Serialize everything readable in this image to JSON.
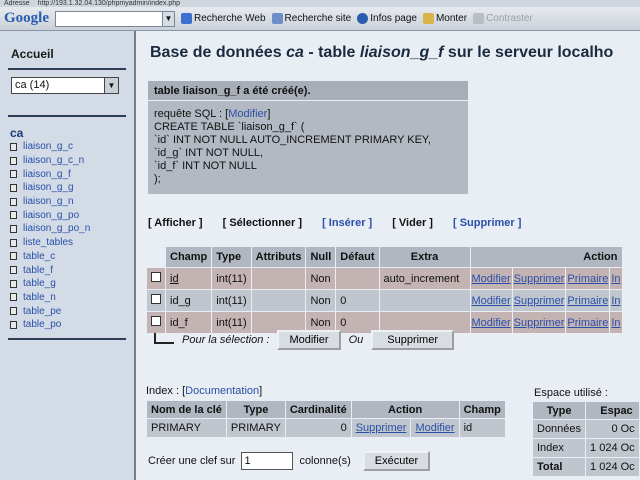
{
  "browser": {
    "address_label": "Adresse",
    "url": "http://193.1.32.04.130/phpmyadmin/index.php"
  },
  "toolbar": {
    "logo": "Google",
    "search_value": "",
    "buttons": [
      "Recherche Web",
      "Recherche site",
      "Infos page",
      "Monter",
      "Contraster"
    ]
  },
  "left": {
    "title": "Accueil",
    "db_select": "ca (14)",
    "db_name": "ca",
    "tables": [
      "liaison_g_c",
      "liaison_g_c_n",
      "liaison_g_f",
      "liaison_g_g",
      "liaison_g_n",
      "liaison_g_po",
      "liaison_g_po_n",
      "liste_tables",
      "table_c",
      "table_f",
      "table_g",
      "table_n",
      "table_pe",
      "table_po"
    ]
  },
  "main": {
    "title_prefix": "Base de données",
    "db": "ca",
    "title_mid": "- table",
    "table": "liaison_g_f",
    "title_suffix": "sur le serveur localho",
    "sql": {
      "header": "table liaison_g_f a été créé(e).",
      "label": "requête SQL :",
      "edit_link": "Modifier",
      "code": "CREATE TABLE `liaison_g_f` (\n`id` INT NOT NULL AUTO_INCREMENT PRIMARY KEY,\n`id_g` INT NOT NULL,\n`id_f` INT NOT NULL\n);"
    },
    "actions": [
      "[ Afficher ]",
      "[ Sélectionner ]",
      "[ Insérer ]",
      "[ Vider ]",
      "[ Supprimer ]"
    ],
    "structure": {
      "headers": [
        "Champ",
        "Type",
        "Attributs",
        "Null",
        "Défaut",
        "Extra",
        "Action"
      ],
      "rows": [
        {
          "champ": "id",
          "type": "int(11)",
          "attr": "",
          "null": "Non",
          "defaut": "",
          "extra": "auto_increment"
        },
        {
          "champ": "id_g",
          "type": "int(11)",
          "attr": "",
          "null": "Non",
          "defaut": "0",
          "extra": ""
        },
        {
          "champ": "id_f",
          "type": "int(11)",
          "attr": "",
          "null": "Non",
          "defaut": "0",
          "extra": ""
        }
      ],
      "row_actions": [
        "Modifier",
        "Supprimer",
        "Primaire",
        "In"
      ]
    },
    "selection": {
      "label": "Pour la sélection :",
      "modify": "Modifier",
      "or": "Ou",
      "delete": "Supprimer"
    },
    "index": {
      "label": "Index :",
      "doc_link": "Documentation",
      "headers": [
        "Nom de la clé",
        "Type",
        "Cardinalité",
        "Action",
        "Champ"
      ],
      "row": {
        "name": "PRIMARY",
        "type": "PRIMARY",
        "card": "0",
        "del": "Supprimer",
        "mod": "Modifier",
        "champ": "id"
      }
    },
    "newkey": {
      "label": "Créer une clef sur",
      "value": "1",
      "unit": "colonne(s)",
      "button": "Exécuter"
    },
    "space": {
      "label": "Espace utilisé :",
      "headers": [
        "Type",
        "Espac"
      ],
      "rows": [
        {
          "type": "Données",
          "value": "0 Oc"
        },
        {
          "type": "Index",
          "value": "1 024 Oc"
        },
        {
          "type": "Total",
          "value": "1 024 Oc"
        }
      ]
    }
  }
}
